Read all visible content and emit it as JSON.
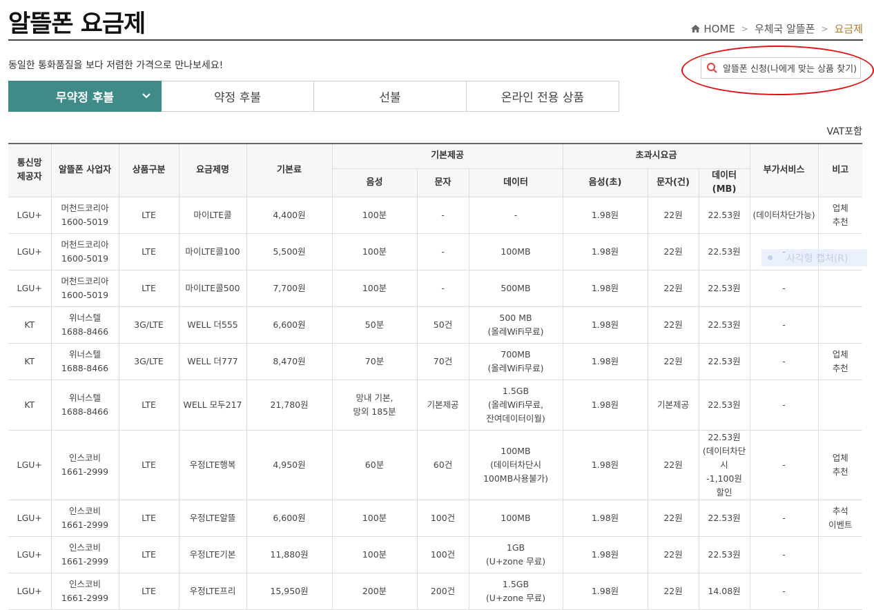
{
  "page": {
    "title": "알뜰폰 요금제",
    "description": "동일한 통화품질을 보다 저렴한 가격으로 만나보세요!",
    "vat_note": "VAT포함"
  },
  "breadcrumb": {
    "home": "HOME",
    "level1": "우체국 알뜰폰",
    "current": "요금제"
  },
  "search": {
    "label": "알뜰폰 신청(나에게 맞는 상품 찾기)"
  },
  "tabs": [
    {
      "label": "무약정 후불"
    },
    {
      "label": "약정 후불"
    },
    {
      "label": "선불"
    },
    {
      "label": "온라인 전용 상품"
    }
  ],
  "table": {
    "headers": {
      "carrier": "통신망\n제공자",
      "mvno": "알뜰폰 사업자",
      "type": "상품구분",
      "plan": "요금제명",
      "fee": "기본료",
      "basic": "기본제공",
      "over": "초과시요금",
      "extra": "부가서비스",
      "note": "비고",
      "voice": "음성",
      "sms": "문자",
      "data": "데이터",
      "over_voice": "음성(초)",
      "over_sms": "문자(건)",
      "over_data": "데이터(MB)"
    },
    "rows": [
      [
        "LGU+",
        "머천드코리아\n1600-5019",
        "LTE",
        "마이LTE콜",
        "4,400원",
        "100분",
        "-",
        "-",
        "1.98원",
        "22원",
        "22.53원",
        "(데이터차단가능)",
        "업체\n추천"
      ],
      [
        "LGU+",
        "머천드코리아\n1600-5019",
        "LTE",
        "마이LTE콜100",
        "5,500원",
        "100분",
        "-",
        "100MB",
        "1.98원",
        "22원",
        "22.53원",
        "-",
        ""
      ],
      [
        "LGU+",
        "머천드코리아\n1600-5019",
        "LTE",
        "마이LTE콜500",
        "7,700원",
        "100분",
        "-",
        "500MB",
        "1.98원",
        "22원",
        "22.53원",
        "-",
        ""
      ],
      [
        "KT",
        "위너스텔\n1688-8466",
        "3G/LTE",
        "WELL 더555",
        "6,600원",
        "50분",
        "50건",
        "500 MB\n(올레WiFi무료)",
        "1.98원",
        "22원",
        "22.53원",
        "-",
        ""
      ],
      [
        "KT",
        "위너스텔\n1688-8466",
        "3G/LTE",
        "WELL 더777",
        "8,470원",
        "70분",
        "70건",
        "700MB\n(올레WiFi무료)",
        "1.98원",
        "22원",
        "22.53원",
        "-",
        "업체\n추천"
      ],
      [
        "KT",
        "위너스텔\n1688-8466",
        "LTE",
        "WELL 모두217",
        "21,780원",
        "망내 기본,\n망외 185분",
        "기본제공",
        "1.5GB\n(올레WiFi무료,\n잔여데이터이월)",
        "1.98원",
        "기본제공",
        "22.53원",
        "-",
        ""
      ],
      [
        "LGU+",
        "인스코비\n1661-2999",
        "LTE",
        "우정LTE행복",
        "4,950원",
        "60분",
        "60건",
        "100MB\n(데이터차단시\n100MB사용불가)",
        "1.98원",
        "22원",
        "22.53원\n(데이터차단시\n-1,100원\n할인",
        "-",
        "업체\n추천"
      ],
      [
        "LGU+",
        "인스코비\n1661-2999",
        "LTE",
        "우정LTE알뜰",
        "6,600원",
        "100분",
        "100건",
        "100MB",
        "1.98원",
        "22원",
        "22.53원",
        "-",
        "추석\n이벤트"
      ],
      [
        "LGU+",
        "인스코비\n1661-2999",
        "LTE",
        "우정LTE기본",
        "11,880원",
        "100분",
        "100건",
        "1GB\n(U+zone 무료)",
        "1.98원",
        "22원",
        "22.53원",
        "-",
        ""
      ],
      [
        "LGU+",
        "인스코비\n1661-2999",
        "LTE",
        "우정LTE프리",
        "15,950원",
        "200분",
        "200건",
        "1.5GB\n(U+zone 무료)",
        "1.98원",
        "22원",
        "14.08원",
        "-",
        ""
      ]
    ]
  },
  "overlay": {
    "capture_label": "사각형 캡처(R)"
  },
  "colors": {
    "tab_active": "#3e8b88",
    "breadcrumb_current": "#b27a2e",
    "annotation": "#e01010"
  }
}
